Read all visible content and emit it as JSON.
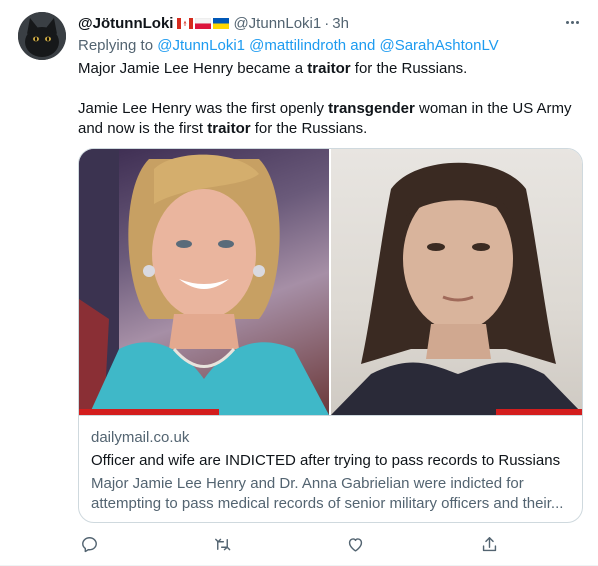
{
  "tweet": {
    "display_name": "@JötunnLoki",
    "flags": [
      "canada-flag",
      "poland-flag",
      "ukraine-flag"
    ],
    "handle": "@JtunnLoki1",
    "dot": "·",
    "time": "3h",
    "replying_prefix": "Replying to",
    "replying_to": [
      {
        "text": "@JtunnLoki1"
      },
      {
        "text": "@mattilindroth"
      },
      {
        "text": "and",
        "plain": true
      },
      {
        "text": "@SarahAshtonLV"
      }
    ],
    "paragraph1": {
      "before": "Major Jamie Lee Henry became a ",
      "bold": "traitor",
      "after": " for the Russians."
    },
    "paragraph2": {
      "part1": "Jamie Lee Henry was the first openly ",
      "bold1": "transgender",
      "part2": " woman in the US Army and now is the first ",
      "bold2": "traitor",
      "part3": " for the Russians."
    }
  },
  "card": {
    "domain": "dailymail.co.uk",
    "title": "Officer and wife are INDICTED after trying to pass records to Russians",
    "description_line1": "Major Jamie Lee Henry and Dr. Anna Gabrielian were indicted for",
    "description_line2": "attempting to pass medical records of senior military officers and their..."
  },
  "actions": [
    "reply-icon",
    "retweet-icon",
    "like-icon",
    "share-icon"
  ],
  "colors": {
    "accent": "#1d9bf0",
    "text": "#0f1419",
    "secondary": "#536471",
    "border": "#cfd9de"
  }
}
